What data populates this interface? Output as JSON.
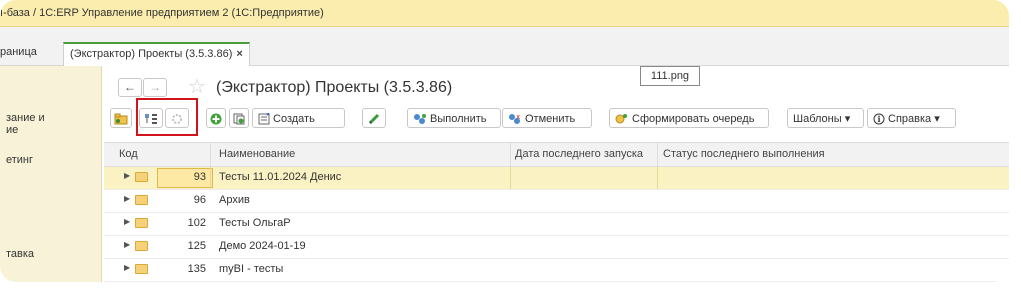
{
  "window": {
    "title": "ı-база / 1С:ERP Управление предприятием 2  (1С:Предприятие)"
  },
  "tabs": [
    {
      "label": "раница"
    },
    {
      "label": "(Экстрактор) Проекты (3.5.3.86)",
      "close": "×"
    }
  ],
  "sidebar": {
    "items": [
      {
        "label": "зание и\nие"
      },
      {
        "label": "етинг"
      },
      {
        "label": "тавка"
      }
    ]
  },
  "form": {
    "back": "←",
    "forward": "→",
    "star": "☆",
    "title": "(Экстрактор) Проекты (3.5.3.86)",
    "tooltip": "111.png"
  },
  "toolbar": {
    "create": "Создать",
    "run": "Выполнить",
    "cancel": "Отменить",
    "queue": "Сформировать очередь",
    "templates": "Шаблоны",
    "help": "Справка",
    "dropdown": "▾"
  },
  "table": {
    "columns": [
      "Код",
      "Наименование",
      "Дата последнего запуска",
      "Статус последнего выполнения"
    ],
    "rows": [
      {
        "code": "93",
        "name": "Тесты 11.01.2024 Денис"
      },
      {
        "code": "96",
        "name": "Архив"
      },
      {
        "code": "102",
        "name": "Тесты ОльгаР"
      },
      {
        "code": "125",
        "name": "Демо 2024-01-19"
      },
      {
        "code": "135",
        "name": "myBI - тесты"
      }
    ]
  },
  "colors": {
    "titlebar": "#fbedad",
    "highlight": "#d0141a",
    "selected_row": "#fbf2c4",
    "tab_accent": "#4a9e3a"
  }
}
